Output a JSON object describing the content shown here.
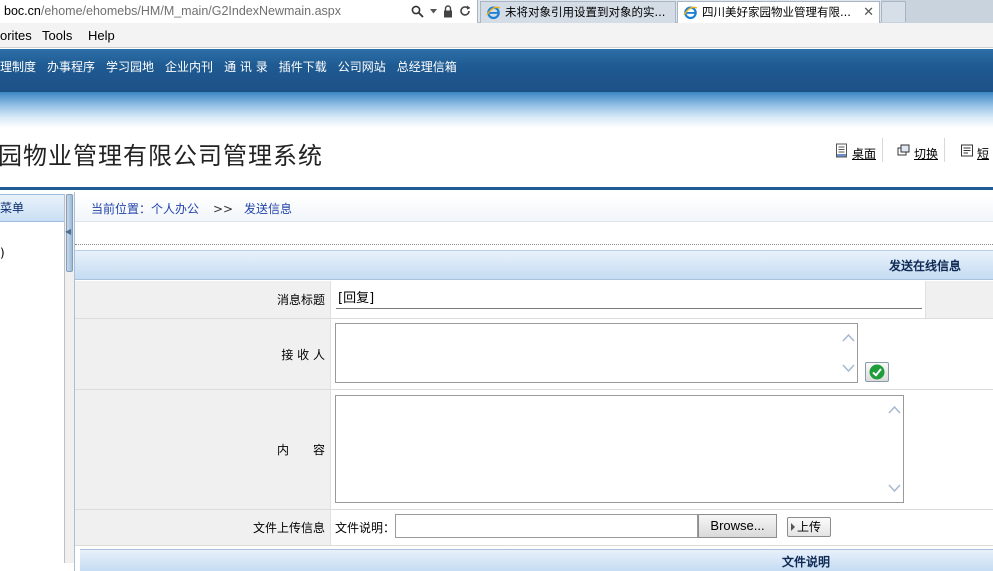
{
  "browser": {
    "address": {
      "domain": "boc.cn",
      "path": "/ehome/ehomebs/HM/M_main/G2IndexNewmain.aspx"
    },
    "tabs": [
      {
        "label": "未将对象引用设置到对象的实..."
      },
      {
        "label": "四川美好家园物业管理有限..."
      }
    ],
    "menu": [
      "orites",
      "Tools",
      "Help"
    ]
  },
  "nav": {
    "links": [
      "理制度",
      "办事程序",
      "学习园地",
      "企业内刊",
      "通 讯 录",
      "插件下载",
      "公司网站",
      "总经理信箱"
    ]
  },
  "header": {
    "system_title": "园物业管理有限公司管理系统",
    "tools": [
      "桌面",
      "切换",
      "短"
    ]
  },
  "sidebar": {
    "head_label": "菜单",
    "item_label": ")"
  },
  "breadcrumb": {
    "label": "当前位置：个人办公",
    "separator": ">>",
    "current": "发送信息"
  },
  "form": {
    "header_title": "发送在线信息",
    "title_label": "消息标题",
    "title_value": "[回复]",
    "receiver_label": "接 收 人",
    "content_label": "内　　容",
    "file_label": "文件上传信息",
    "file_desc_label": "文件说明：",
    "browse_label": "Browse...",
    "upload_label": "上传",
    "file_table_head": "文件说明"
  },
  "colors": {
    "nav_blue": "#1f5a92",
    "header_line": "#1f5c97",
    "link_blue": "#2244aa",
    "check_green": "#1e9d3a"
  },
  "icons": {
    "address": [
      "search-icon",
      "dropdown-arrow-icon",
      "lock-icon",
      "refresh-icon"
    ],
    "tabs": [
      "ie-logo-icon",
      "close-icon"
    ],
    "header_tools": [
      "desktop-icon",
      "switch-icon",
      "sms-icon"
    ],
    "receiver_action": "check-icon"
  }
}
